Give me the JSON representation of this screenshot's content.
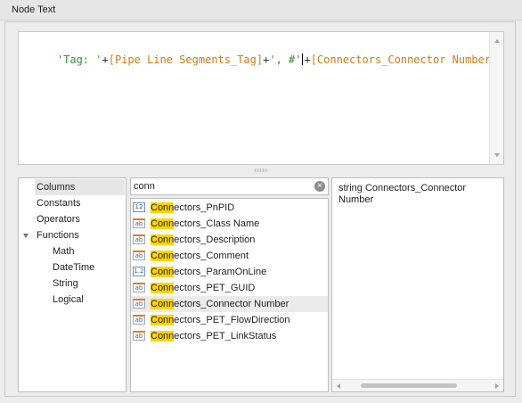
{
  "window": {
    "title": "Node Text"
  },
  "editor": {
    "tokens": [
      {
        "text": "'Tag: '",
        "kind": "str"
      },
      {
        "text": "+",
        "kind": "op"
      },
      {
        "text": "[Pipe Line Segments_Tag]",
        "kind": "fld"
      },
      {
        "text": "+",
        "kind": "op"
      },
      {
        "text": "', #'",
        "kind": "str"
      },
      {
        "text": "+",
        "kind": "op"
      },
      {
        "text": "[Connectors_Connector Number]",
        "kind": "fld"
      }
    ]
  },
  "categories": [
    {
      "label": "Columns",
      "level": 0,
      "selected": true
    },
    {
      "label": "Constants",
      "level": 0
    },
    {
      "label": "Operators",
      "level": 0
    },
    {
      "label": "Functions",
      "level": 0,
      "expanded": true
    },
    {
      "label": "Math",
      "level": 1
    },
    {
      "label": "DateTime",
      "level": 1
    },
    {
      "label": "String",
      "level": 1
    },
    {
      "label": "Logical",
      "level": 1
    }
  ],
  "search": {
    "value": "conn",
    "clear_icon": "clear-icon"
  },
  "fields": [
    {
      "match": "Conn",
      "rest": "ectors_PnPID",
      "type_icon": "12",
      "icon_kind": "int"
    },
    {
      "match": "Conn",
      "rest": "ectors_Class Name",
      "type_icon": "ab",
      "icon_kind": "string"
    },
    {
      "match": "Conn",
      "rest": "ectors_Description",
      "type_icon": "ab",
      "icon_kind": "string"
    },
    {
      "match": "Conn",
      "rest": "ectors_Comment",
      "type_icon": "ab",
      "icon_kind": "string"
    },
    {
      "match": "Conn",
      "rest": "ectors_ParamOnLine",
      "type_icon": "1.2",
      "icon_kind": "float"
    },
    {
      "match": "Conn",
      "rest": "ectors_PET_GUID",
      "type_icon": "ab",
      "icon_kind": "string"
    },
    {
      "match": "Conn",
      "rest": "ectors_Connector Number",
      "type_icon": "ab",
      "icon_kind": "string",
      "selected": true
    },
    {
      "match": "Conn",
      "rest": "ectors_PET_FlowDirection",
      "type_icon": "ab",
      "icon_kind": "string"
    },
    {
      "match": "Conn",
      "rest": "ectors_PET_LinkStatus",
      "type_icon": "ab",
      "icon_kind": "string"
    }
  ],
  "description": {
    "text": "string Connectors_Connector Number"
  },
  "colors": {
    "string_literal": "#3a8a3a",
    "field": "#d07a10",
    "highlight": "#ffd400"
  }
}
